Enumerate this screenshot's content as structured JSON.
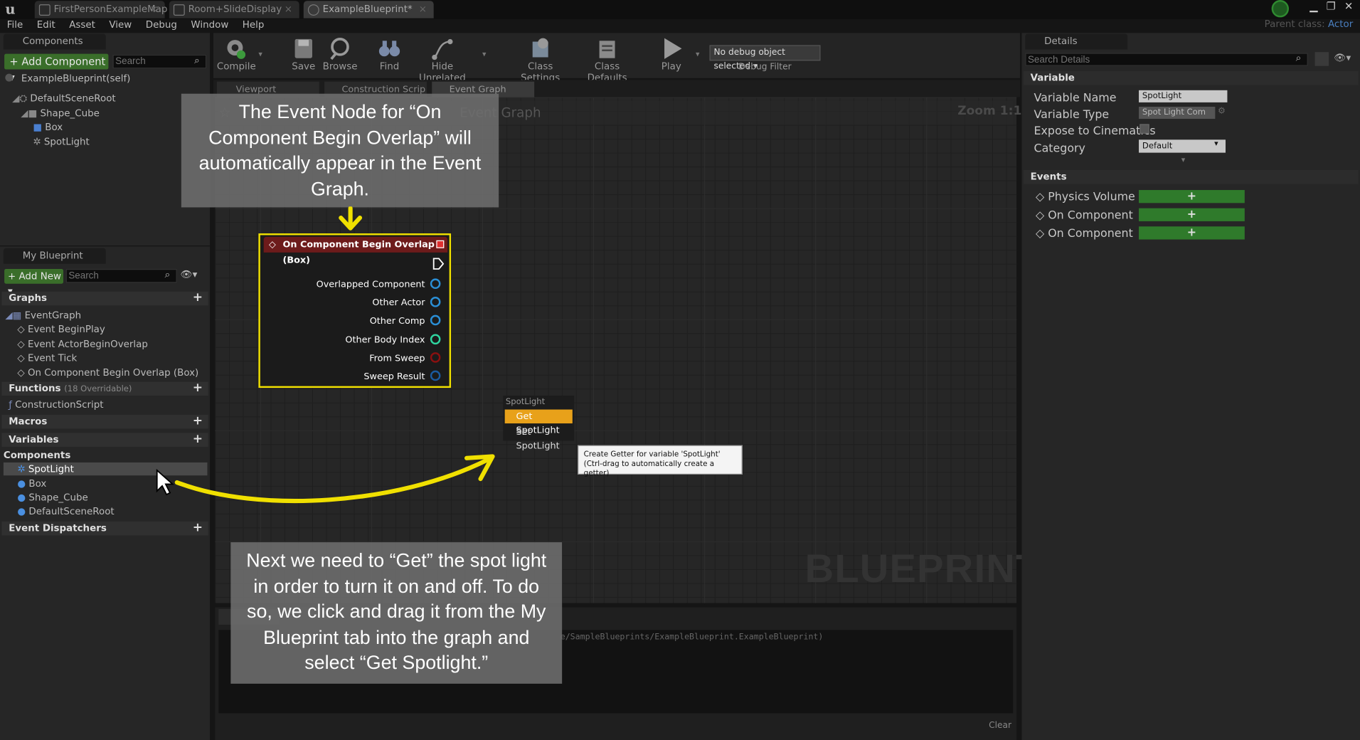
{
  "titlebar": {
    "tabs": [
      "FirstPersonExampleMap",
      "Room+SlideDisplay",
      "ExampleBlueprint*"
    ],
    "parent_class_label": "Parent class:",
    "parent_class_value": "Actor"
  },
  "menu": [
    "File",
    "Edit",
    "Asset",
    "View",
    "Debug",
    "Window",
    "Help"
  ],
  "toolbar": {
    "compile": "Compile",
    "save": "Save",
    "browse": "Browse",
    "find": "Find",
    "hide_unrelated": "Hide Unrelated",
    "class_settings": "Class Settings",
    "class_defaults": "Class Defaults",
    "play": "Play",
    "debug_select": "No debug object selected ▾",
    "debug_filter": "Debug Filter"
  },
  "components_panel": {
    "title": "Components",
    "add_button": "+ Add Component ▾",
    "search_placeholder": "Search",
    "self_label": "ExampleBlueprint(self)",
    "tree": [
      "DefaultSceneRoot",
      "Shape_Cube",
      "Box",
      "SpotLight"
    ]
  },
  "my_blueprint": {
    "title": "My Blueprint",
    "add_new": "+ Add New ▾",
    "search_placeholder": "Search",
    "graphs_header": "Graphs",
    "event_graph": "EventGraph",
    "events": [
      "Event BeginPlay",
      "Event ActorBeginOverlap",
      "Event Tick",
      "On Component Begin Overlap (Box)"
    ],
    "functions_header": "Functions",
    "functions_count": "(18 Overridable)",
    "construction_script": "ConstructionScript",
    "macros_header": "Macros",
    "variables_header": "Variables",
    "components_header": "Components",
    "components": [
      "SpotLight",
      "Box",
      "Shape_Cube",
      "DefaultSceneRoot"
    ],
    "dispatchers_header": "Event Dispatchers"
  },
  "graph": {
    "tabs": [
      "Viewport",
      "Construction Scrip",
      "Event Graph"
    ],
    "breadcrumb": "Event Graph",
    "zoom": "Zoom 1:1",
    "watermark": "BLUEPRINT"
  },
  "event_node": {
    "title": "On Component Begin Overlap (Box)",
    "pins": [
      "Overlapped Component",
      "Other Actor",
      "Other Comp",
      "Other Body Index",
      "From Sweep",
      "Sweep Result"
    ]
  },
  "context_menu": {
    "header": "SpotLight",
    "items": [
      "Get SpotLight",
      "Set SpotLight"
    ]
  },
  "tooltip": {
    "line1": "Create Getter for variable 'SpotLight'",
    "line2": "(Ctrl-drag to automatically create a getter)"
  },
  "overlays": {
    "top": "The Event Node for “On Component Begin Overlap” will automatically appear in the Event Graph.",
    "bottom": "Next we need to “Get” the spot light in order to turn it on and off. To do so, we click and drag it from the My Blueprint tab into the graph and select “Get Spotlight.”"
  },
  "output_log": {
    "text": "e/SampleBlueprints/ExampleBlueprint.ExampleBlueprint)",
    "clear": "Clear"
  },
  "details": {
    "title": "Details",
    "search_placeholder": "Search Details",
    "variable_header": "Variable",
    "rows": [
      {
        "label": "Variable Name",
        "value": "SpotLight"
      },
      {
        "label": "Variable Type",
        "value": "Spot Light Com"
      },
      {
        "label": "Expose to Cinematics",
        "value": ""
      },
      {
        "label": "Category",
        "value": "Default"
      }
    ],
    "events_header": "Events",
    "events": [
      "Physics Volume Change",
      "On Component Activated",
      "On Component Deactiva"
    ]
  },
  "colors": {
    "accent_yellow": "#f0e000",
    "node_header": "#6d1b1b",
    "green_button": "#3a6e2a",
    "selection": "#e8a11a"
  }
}
